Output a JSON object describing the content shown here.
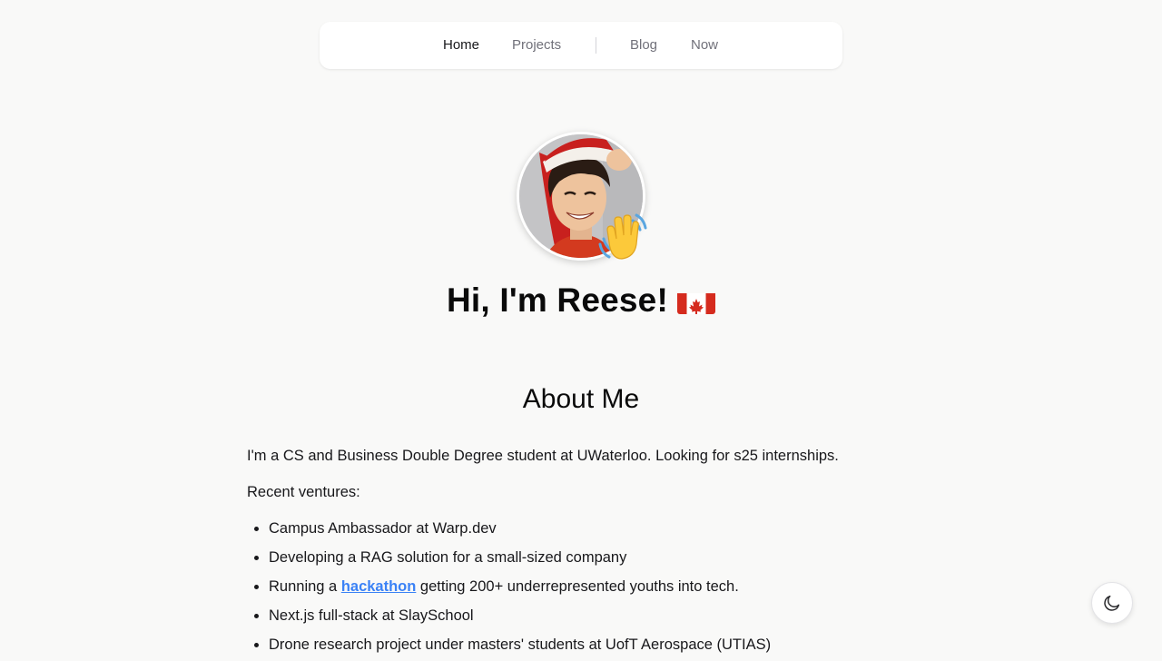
{
  "nav": {
    "items": [
      {
        "label": "Home",
        "active": true
      },
      {
        "label": "Projects",
        "active": false
      },
      {
        "label": "Blog",
        "active": false
      },
      {
        "label": "Now",
        "active": false
      }
    ]
  },
  "hero": {
    "title": "Hi, I'm Reese!",
    "flag_icon": "canada-flag-icon",
    "badge_icon": "waving-hand-icon"
  },
  "about": {
    "title": "About Me",
    "intro": "I'm a CS and Business Double Degree student at UWaterloo. Looking for s25 internships.",
    "ventures_label": "Recent ventures:",
    "ventures": [
      {
        "text": "Campus Ambassador at Warp.dev"
      },
      {
        "text": "Developing a RAG solution for a small-sized company"
      },
      {
        "before": "Running a ",
        "link": "hackathon",
        "after": " getting 200+ underrepresented youths into tech."
      },
      {
        "text": "Next.js full-stack at SlaySchool"
      },
      {
        "text": "Drone research project under masters' students at UofT Aerospace (UTIAS)"
      }
    ]
  },
  "theme_toggle": {
    "icon": "moon-icon"
  },
  "colors": {
    "background": "#f9f9f8",
    "link": "#3b82f6",
    "nav_inactive": "#71717a",
    "text": "#18181b"
  }
}
